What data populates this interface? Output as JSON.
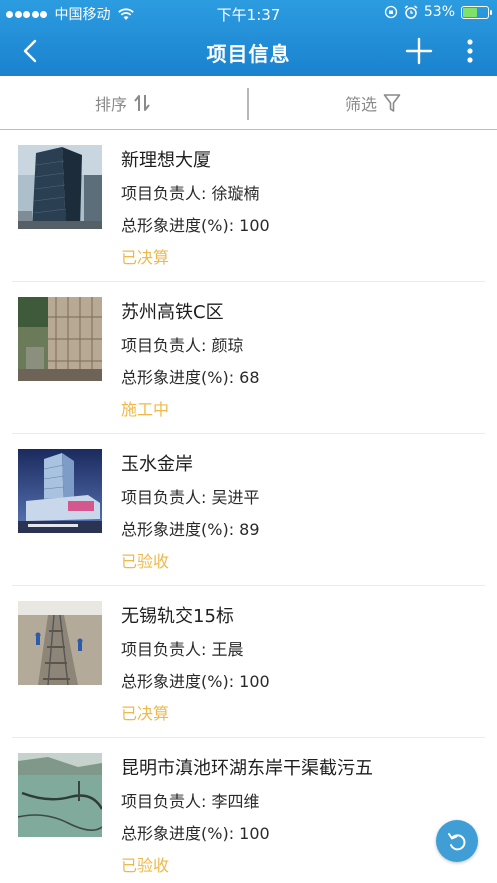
{
  "status_bar": {
    "carrier": "中国移动",
    "time": "下午1:37",
    "battery_text": "53%",
    "battery_level": 0.53
  },
  "nav": {
    "title": "项目信息",
    "back_icon": "chevron-left-icon",
    "add_icon": "plus-icon",
    "more_icon": "more-vertical-icon"
  },
  "toolbar": {
    "sort_label": "排序",
    "filter_label": "筛选"
  },
  "colors": {
    "header_top": "#2c9ce0",
    "header_bottom": "#1a82cf",
    "status_text": "#f0b84a",
    "fab": "#3f9ed6"
  },
  "projects": [
    {
      "name": "新理想大厦",
      "manager": "项目负责人: 徐璇楠",
      "progress": "总形象进度(%): 100",
      "status": "已决算"
    },
    {
      "name": "苏州高铁C区",
      "manager": "项目负责人: 颜琼",
      "progress": "总形象进度(%): 68",
      "status": "施工中"
    },
    {
      "name": "玉水金岸",
      "manager": "项目负责人: 吴进平",
      "progress": "总形象进度(%): 89",
      "status": "已验收"
    },
    {
      "name": "无锡轨交15标",
      "manager": "项目负责人: 王晨",
      "progress": "总形象进度(%): 100",
      "status": "已决算"
    },
    {
      "name": "昆明市滇池环湖东岸干渠截污五",
      "manager": "项目负责人: 李四维",
      "progress": "总形象进度(%): 100",
      "status": "已验收"
    }
  ],
  "fab_icon": "return-icon"
}
